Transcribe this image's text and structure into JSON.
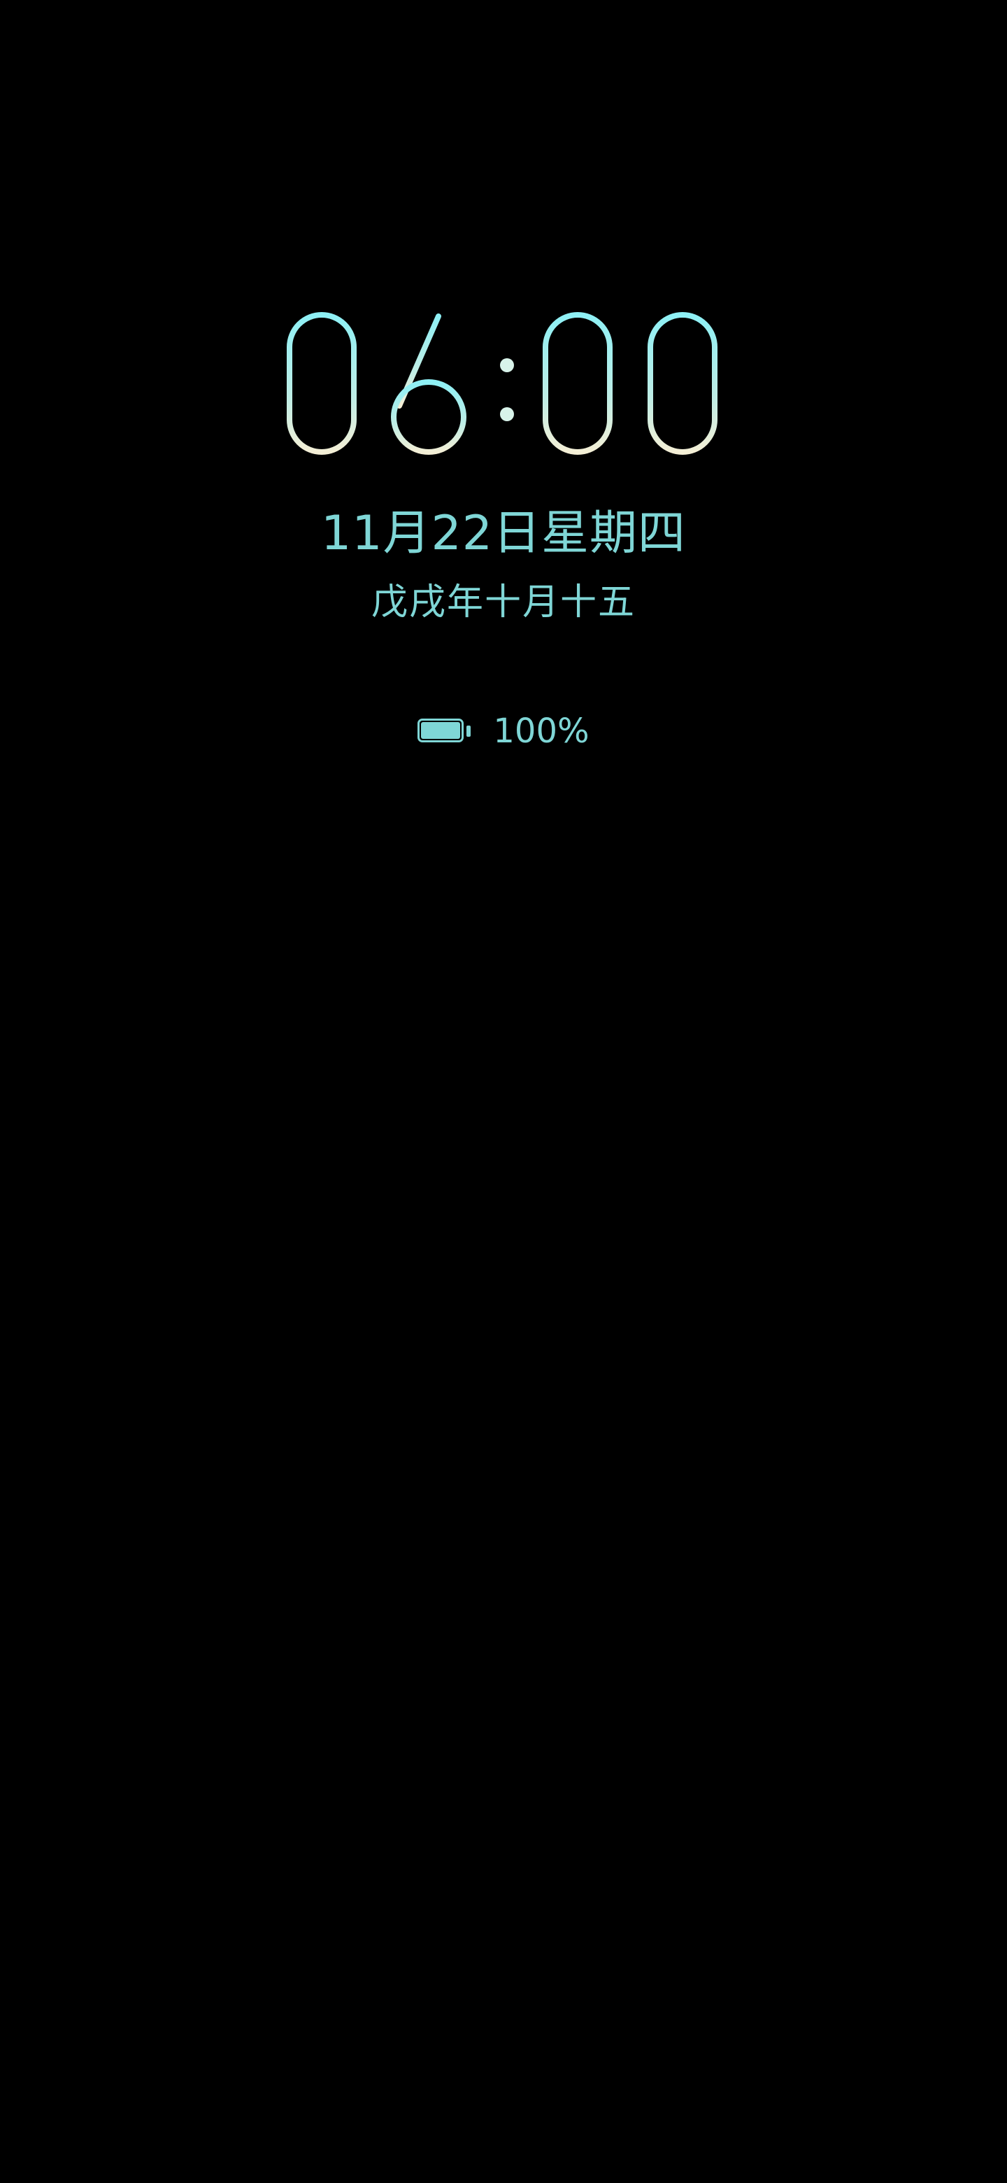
{
  "colors": {
    "background": "#000000",
    "accent": "#7fd6d6",
    "clock_gradient_top": "#8ef0f5",
    "clock_gradient_bottom": "#f4efd6"
  },
  "clock": {
    "time": "06:00"
  },
  "date": {
    "text": "11月22日星期四",
    "lunar": "戊戌年十月十五"
  },
  "battery": {
    "icon": "battery-icon",
    "percent_text": "100%",
    "level": 1.0
  }
}
